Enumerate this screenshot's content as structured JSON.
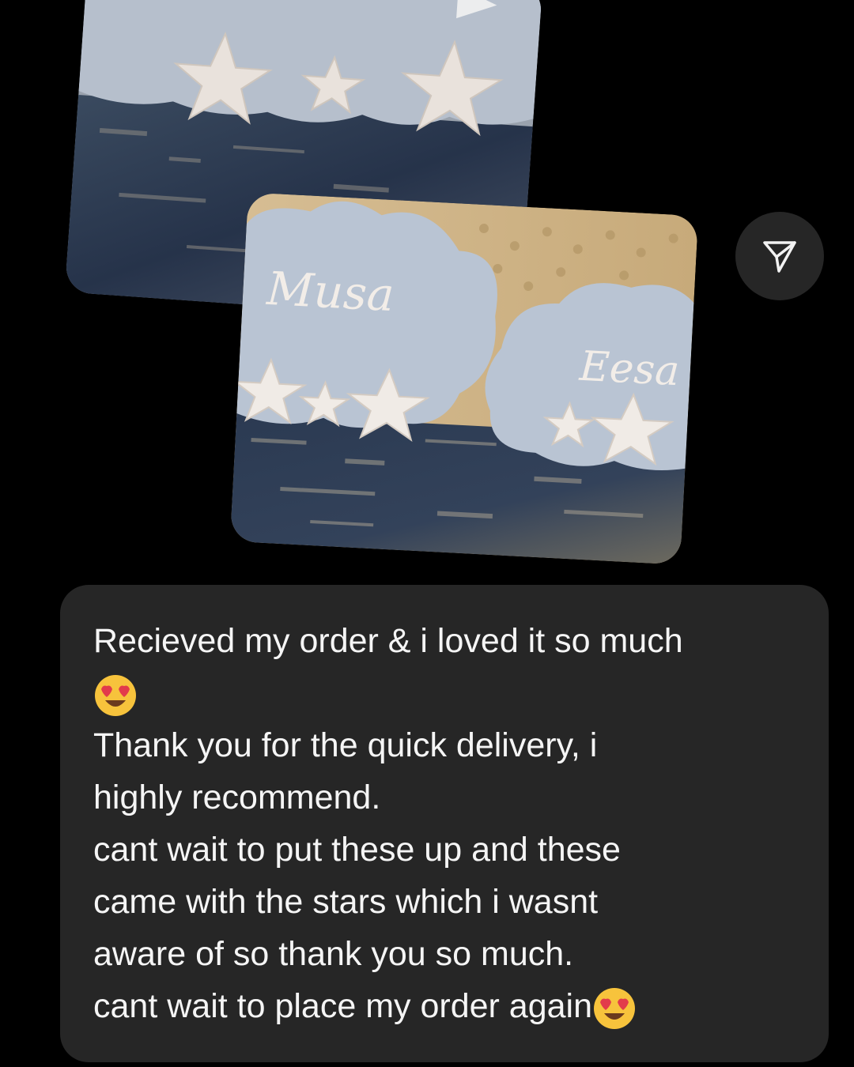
{
  "message": {
    "lines": [
      "Recieved my order & i loved it so much",
      "",
      "Thank you for the quick delivery, i",
      "highly recommend.",
      "cant wait to put these up and these",
      "came with the stars which i wasnt",
      "aware of so thank you so much.",
      "cant wait to place my order again"
    ],
    "emoji": "heart-eyes-emoji"
  },
  "photos": {
    "front_names": [
      "Musa",
      "Eesa"
    ]
  },
  "share_button": {
    "icon": "paper-plane-icon"
  },
  "colors": {
    "background": "#000000",
    "bubble": "#262626",
    "text": "#f5f5f5",
    "cloud": "#b9c4d3",
    "star": "#e9e2dc",
    "carpet": "#2f3b4c"
  }
}
